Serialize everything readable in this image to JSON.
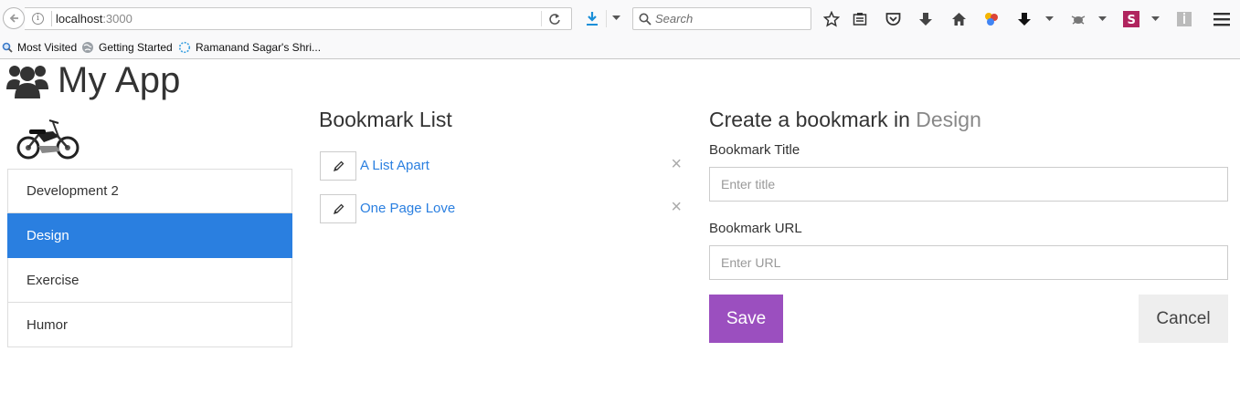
{
  "browser": {
    "url_host": "localhost",
    "url_port": ":3000",
    "search_placeholder": "Search",
    "icons": [
      "back-icon",
      "info-icon",
      "reload-icon",
      "download-icon",
      "search-icon",
      "star-icon",
      "reader-icon",
      "pocket-icon",
      "arrow-down-icon",
      "home-icon",
      "colors-icon",
      "arrow-down-icon",
      "bug-icon",
      "s-icon",
      "sidebar-icon",
      "menu-icon"
    ]
  },
  "bookmarks_bar": [
    {
      "label": "Most Visited",
      "icon": "magnifier-icon"
    },
    {
      "label": "Getting Started",
      "icon": "globe-icon"
    },
    {
      "label": "Ramanand Sagar's Shri...",
      "icon": "spinner-icon"
    }
  ],
  "app": {
    "title": "My App",
    "logo_icon": "users-icon",
    "image_icon": "motorcycle-icon"
  },
  "categories": [
    {
      "label": "Development 2",
      "active": false
    },
    {
      "label": "Design",
      "active": true
    },
    {
      "label": "Exercise",
      "active": false
    },
    {
      "label": "Humor",
      "active": false
    }
  ],
  "bookmark_list": {
    "title": "Bookmark List",
    "items": [
      {
        "title": "A List Apart",
        "delete_glyph": "×"
      },
      {
        "title": "One Page Love",
        "delete_glyph": "×"
      }
    ]
  },
  "form": {
    "title_prefix": "Create a bookmark in",
    "category": "Design",
    "title_label": "Bookmark Title",
    "title_placeholder": "Enter title",
    "url_label": "Bookmark URL",
    "url_placeholder": "Enter URL",
    "save_label": "Save",
    "cancel_label": "Cancel"
  },
  "colors": {
    "active_category": "#2a7fe0",
    "link": "#2a7fe0",
    "save_button": "#9b4fbf",
    "cancel_button": "#eeeeee"
  }
}
